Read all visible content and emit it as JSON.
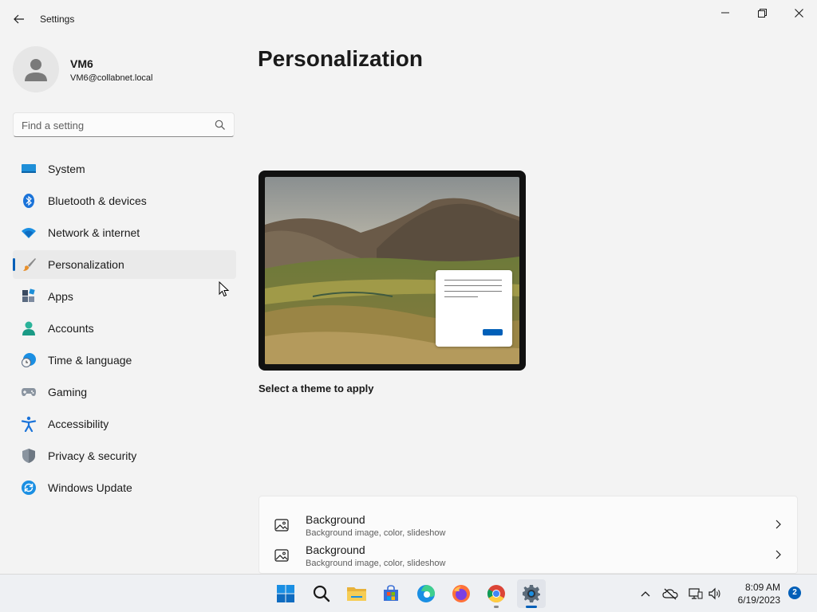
{
  "window": {
    "title": "Settings"
  },
  "user": {
    "name": "VM6",
    "email": "VM6@collabnet.local"
  },
  "search": {
    "placeholder": "Find a setting"
  },
  "nav": {
    "items": [
      {
        "label": "System",
        "icon": "system-icon"
      },
      {
        "label": "Bluetooth & devices",
        "icon": "bluetooth-icon"
      },
      {
        "label": "Network & internet",
        "icon": "wifi-icon"
      },
      {
        "label": "Personalization",
        "icon": "paintbrush-icon",
        "selected": true
      },
      {
        "label": "Apps",
        "icon": "apps-icon"
      },
      {
        "label": "Accounts",
        "icon": "person-icon"
      },
      {
        "label": "Time & language",
        "icon": "globe-clock-icon"
      },
      {
        "label": "Gaming",
        "icon": "gamepad-icon"
      },
      {
        "label": "Accessibility",
        "icon": "accessibility-icon"
      },
      {
        "label": "Privacy & security",
        "icon": "shield-icon"
      },
      {
        "label": "Windows Update",
        "icon": "update-icon"
      }
    ]
  },
  "page": {
    "title": "Personalization",
    "theme_caption": "Select a theme to apply"
  },
  "settings": {
    "rows": [
      {
        "title": "Background",
        "subtitle": "Background image, color, slideshow",
        "icon": "image-icon"
      },
      {
        "title": "Background",
        "subtitle": "Background image, color, slideshow",
        "icon": "image-icon"
      }
    ]
  },
  "taskbar": {
    "apps": [
      "start-icon",
      "search-icon",
      "file-explorer-icon",
      "store-icon",
      "edge-icon",
      "firefox-icon",
      "chrome-icon",
      "settings-icon"
    ],
    "time": "8:09 AM",
    "date": "6/19/2023",
    "notification_count": "2"
  },
  "colors": {
    "accent": "#005fb8",
    "background": "#f3f3f3",
    "card": "#fbfbfb"
  }
}
